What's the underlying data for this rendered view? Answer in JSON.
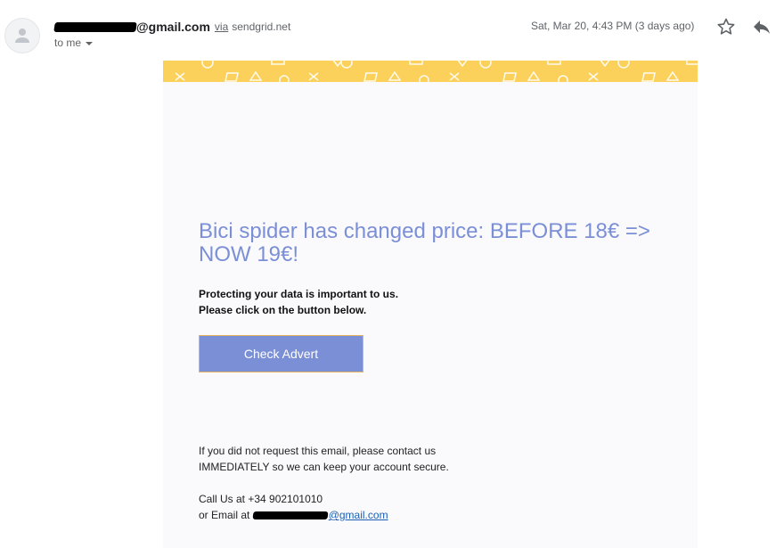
{
  "header": {
    "sender_domain": "@gmail.com",
    "via_word": "via",
    "via_domain": "sendgrid.net",
    "recipient": "to me",
    "date": "Sat, Mar 20, 4:43 PM (3 days ago)"
  },
  "email": {
    "headline": "Bici spider has changed price: BEFORE 18€ => NOW 19€!",
    "intro_line1": "Protecting your data is important to us.",
    "intro_line2": "Please click on the button below.",
    "button_label": "Check Advert",
    "note_line1": "If you did not request this email, please contact us",
    "note_line2": "IMMEDIATELY so we can keep your account secure.",
    "call_us": "Call Us at +34 902101010",
    "email_prefix": "or Email at",
    "email_link_visible": "@gmail.com"
  },
  "colors": {
    "accent": "#7b8fd6",
    "banner": "#fcd15b",
    "card_bg": "#fafafc"
  },
  "icons": [
    "avatar-person-icon",
    "caret-down-icon",
    "star-icon",
    "reply-icon"
  ]
}
